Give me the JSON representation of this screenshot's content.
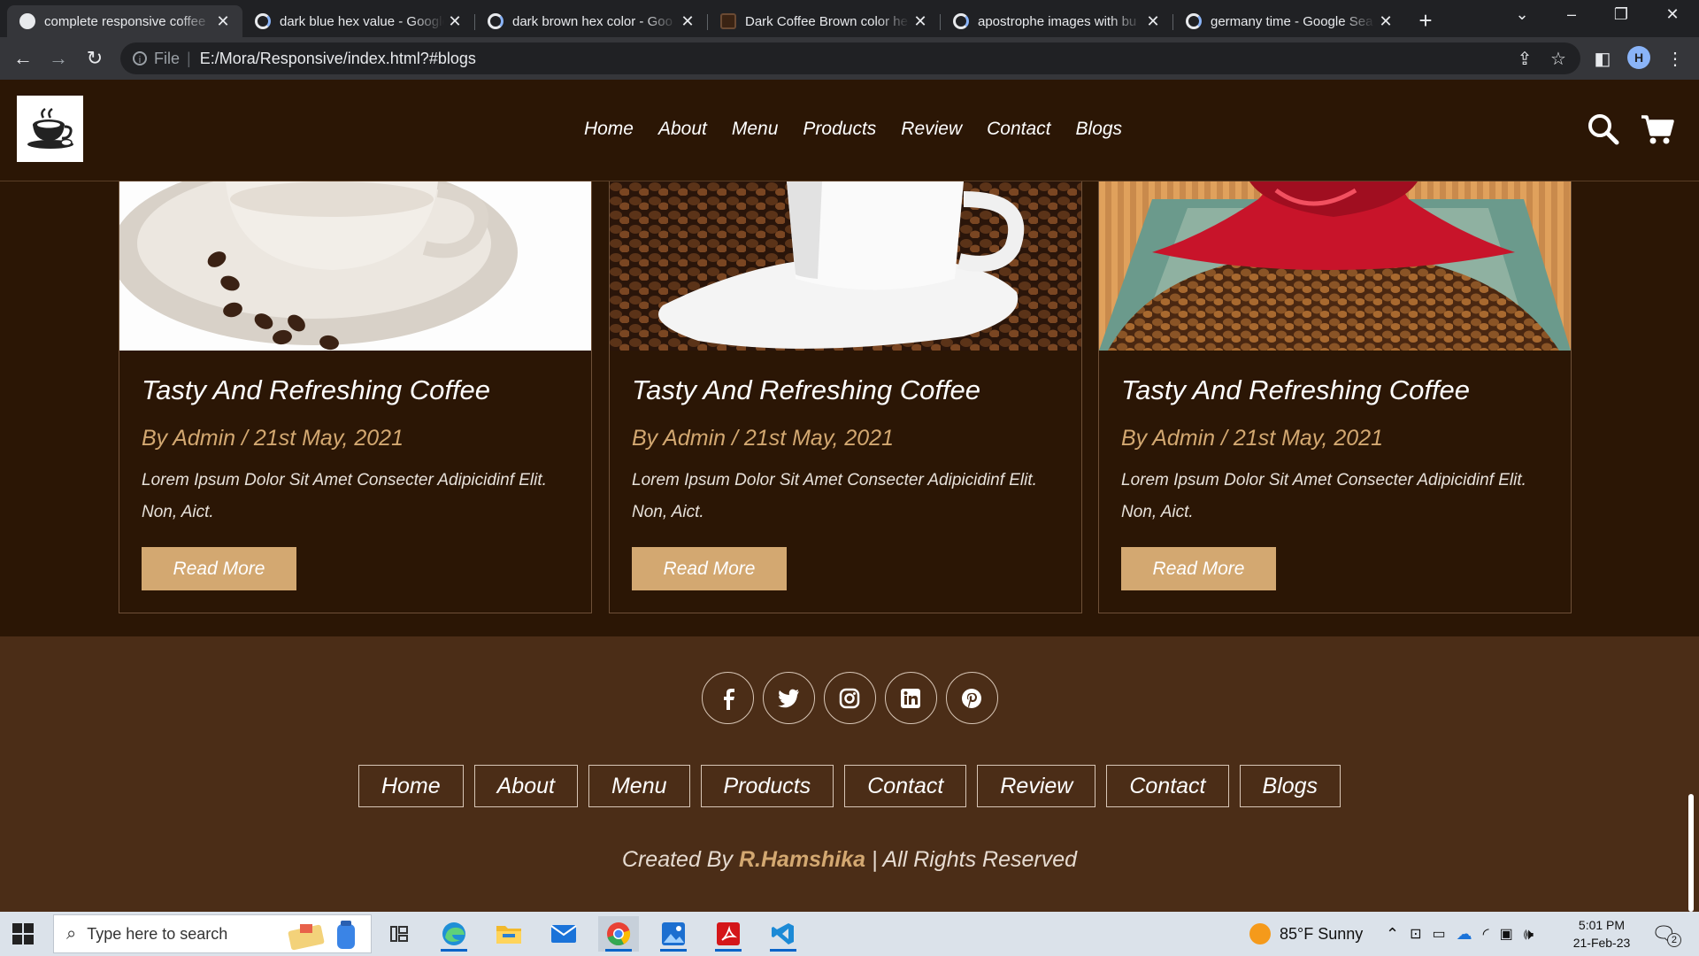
{
  "browser": {
    "tabs": [
      {
        "label": "complete responsive coffee",
        "active": true,
        "icon": "page-icon"
      },
      {
        "label": "dark blue hex value - Google",
        "icon": "google-icon"
      },
      {
        "label": "dark brown hex color - Goo",
        "icon": "google-icon"
      },
      {
        "label": "Dark Coffee Brown color he",
        "icon": "doc-icon"
      },
      {
        "label": "apostrophe images with bu",
        "icon": "google-icon"
      },
      {
        "label": "germany time - Google Sea",
        "icon": "google-icon"
      }
    ],
    "address": {
      "scheme_label": "File",
      "url": "E:/Mora/Responsive/index.html?#blogs"
    },
    "profile_initial": "H"
  },
  "header": {
    "nav": [
      "Home",
      "About",
      "Menu",
      "Products",
      "Review",
      "Contact",
      "Blogs"
    ]
  },
  "blogs": {
    "cards": [
      {
        "title": "Tasty And Refreshing Coffee",
        "meta": "By Admin / 21st May, 2021",
        "body": "Lorem Ipsum Dolor Sit Amet Consecter Adipicidinf Elit. Non, Aict.",
        "button": "Read More"
      },
      {
        "title": "Tasty And Refreshing Coffee",
        "meta": "By Admin / 21st May, 2021",
        "body": "Lorem Ipsum Dolor Sit Amet Consecter Adipicidinf Elit. Non, Aict.",
        "button": "Read More"
      },
      {
        "title": "Tasty And Refreshing Coffee",
        "meta": "By Admin / 21st May, 2021",
        "body": "Lorem Ipsum Dolor Sit Amet Consecter Adipicidinf Elit. Non, Aict.",
        "button": "Read More"
      }
    ]
  },
  "footer": {
    "social": [
      "facebook-icon",
      "twitter-icon",
      "instagram-icon",
      "linkedin-icon",
      "pinterest-icon"
    ],
    "links": [
      "Home",
      "About",
      "Menu",
      "Products",
      "Contact",
      "Review",
      "Contact",
      "Blogs"
    ],
    "credit_prefix": "Created By ",
    "credit_author": "R.Hamshika",
    "credit_suffix": " | All Rights Reserved"
  },
  "taskbar": {
    "search_placeholder": "Type here to search",
    "weather": "85°F  Sunny",
    "time": "5:01 PM",
    "date": "21-Feb-23",
    "notification_count": "2"
  },
  "colors": {
    "page_bg": "#2b1605",
    "footer_bg": "#4b2d17",
    "accent": "#d3a871"
  }
}
